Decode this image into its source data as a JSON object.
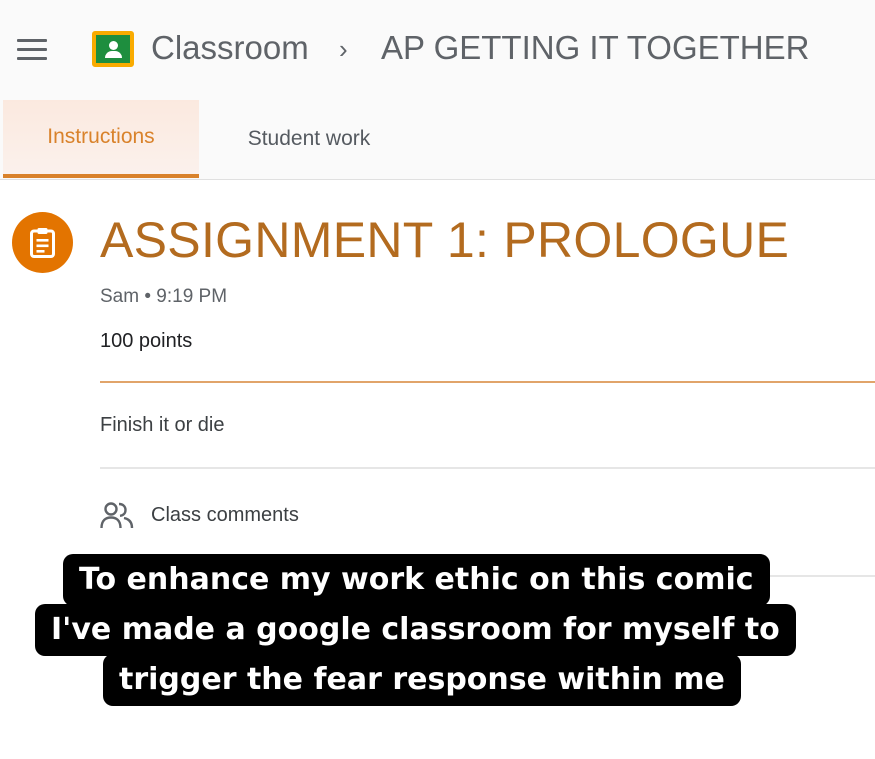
{
  "header": {
    "app_title": "Classroom",
    "breadcrumb_separator": "›",
    "class_name": "AP GETTING IT TOGETHER"
  },
  "tabs": [
    {
      "label": "Instructions",
      "active": true
    },
    {
      "label": "Student work",
      "active": false
    }
  ],
  "assignment": {
    "title": "ASSIGNMENT 1: PROLOGUE",
    "meta": "Sam • 9:19 PM",
    "points": "100 points",
    "description": "Finish it or die",
    "comments_label": "Class comments"
  },
  "caption": {
    "lines": [
      "To enhance my work ethic on this comic",
      "I've made a google classroom for myself to",
      "trigger the fear response within me"
    ]
  },
  "icons": {
    "menu": "menu-icon",
    "logo": "classroom-logo-icon",
    "assignment": "assignment-icon",
    "comments": "people-icon"
  },
  "colors": {
    "accent": "#d9822b",
    "title": "#b36b1f",
    "assignment_icon_bg": "#e37400",
    "logo_green": "#1e8e3e",
    "logo_border": "#f9ab00"
  }
}
